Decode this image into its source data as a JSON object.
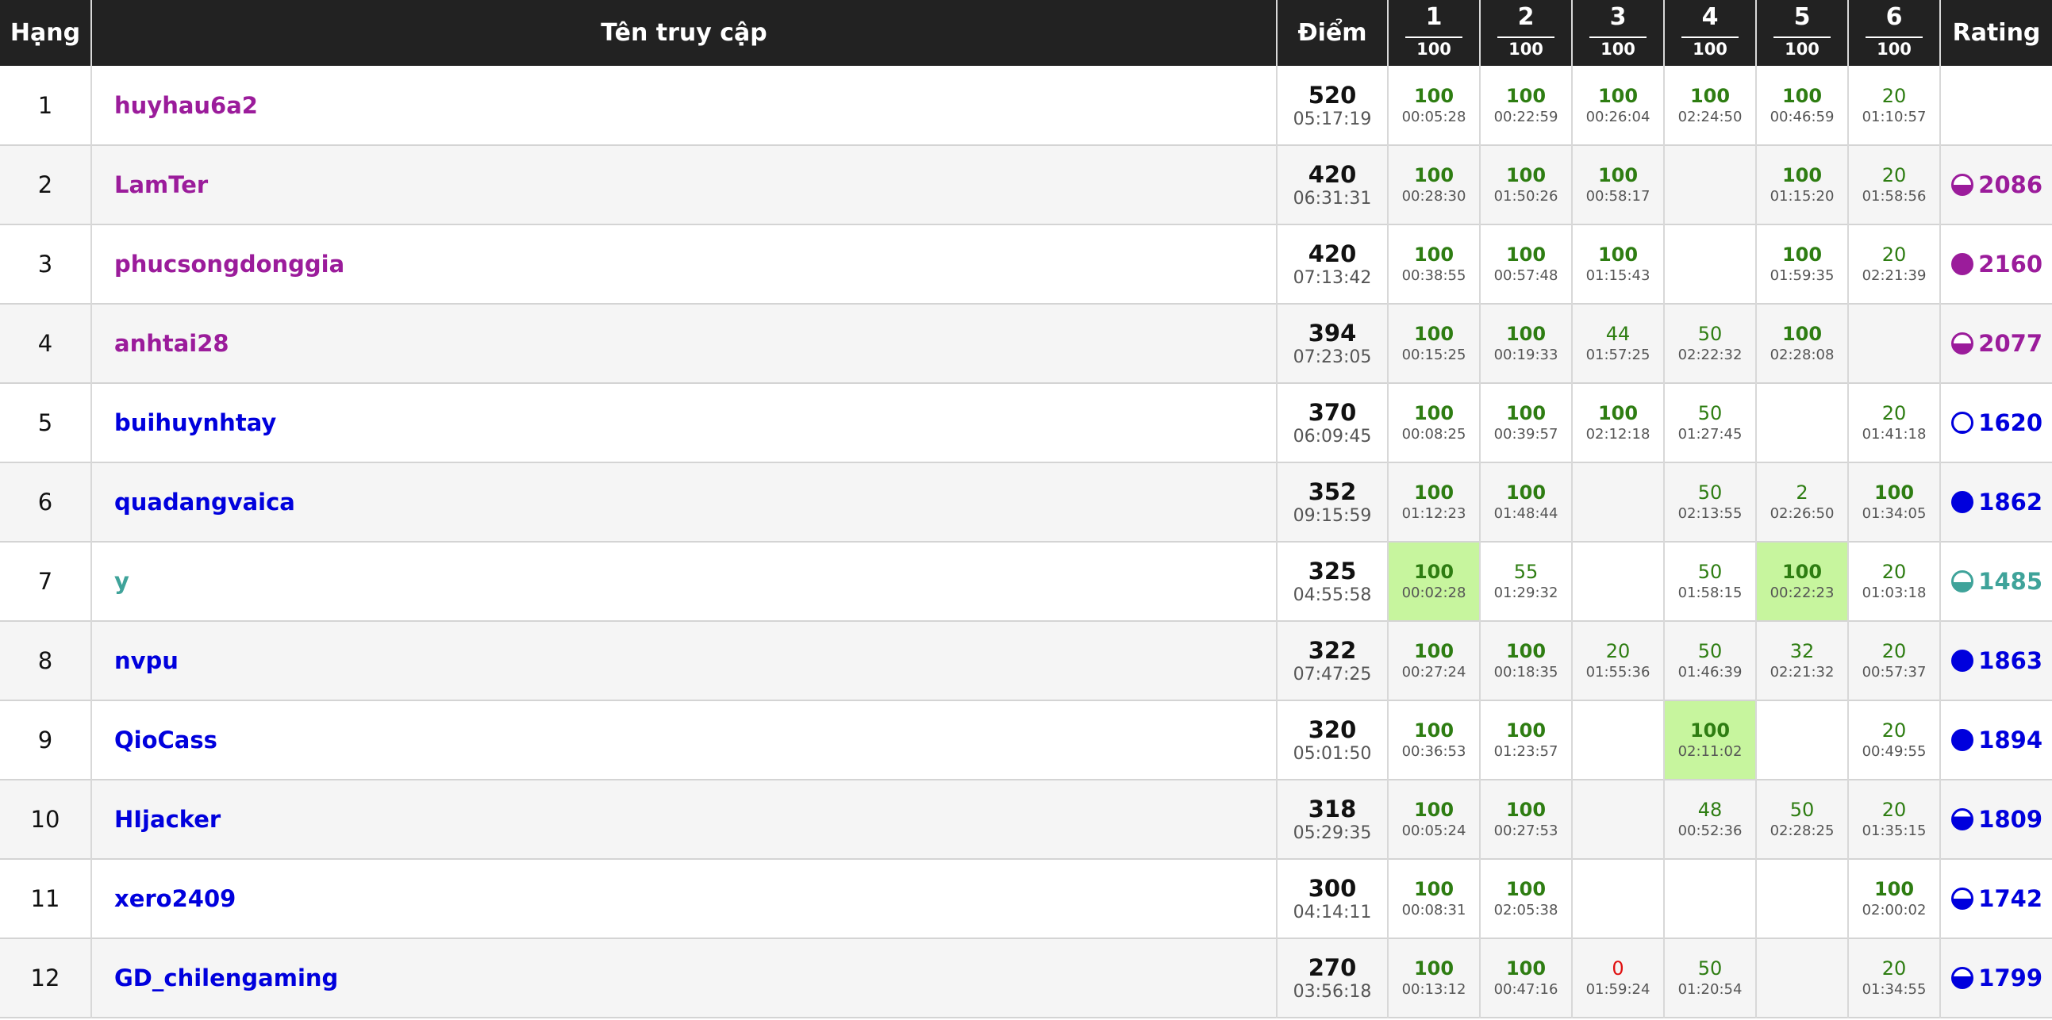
{
  "headers": {
    "rank": "Hạng",
    "username": "Tên truy cập",
    "points": "Điểm",
    "problems": [
      {
        "num": "1",
        "max": "100"
      },
      {
        "num": "2",
        "max": "100"
      },
      {
        "num": "3",
        "max": "100"
      },
      {
        "num": "4",
        "max": "100"
      },
      {
        "num": "5",
        "max": "100"
      },
      {
        "num": "6",
        "max": "100"
      }
    ],
    "rating": "Rating"
  },
  "colors": {
    "purple": "#9b1c9b",
    "blue": "#0000dd",
    "teal": "#3fa39a",
    "score_green": "#2e7d12",
    "score_red": "#e01010",
    "first_solve_bg": "#c7f59e"
  },
  "rows": [
    {
      "rank": "1",
      "user": "huyhau6a2",
      "user_color": "#9b1c9b",
      "points": "520",
      "time": "05:17:19",
      "problems": [
        {
          "score": "100",
          "time": "00:05:28"
        },
        {
          "score": "100",
          "time": "00:22:59"
        },
        {
          "score": "100",
          "time": "00:26:04"
        },
        {
          "score": "100",
          "time": "02:24:50"
        },
        {
          "score": "100",
          "time": "00:46:59"
        },
        {
          "score": "20",
          "time": "01:10:57"
        }
      ],
      "rating": {
        "value": "",
        "color": "#9b1c9b",
        "fill": 0
      }
    },
    {
      "rank": "2",
      "user": "LamTer",
      "user_color": "#9b1c9b",
      "points": "420",
      "time": "06:31:31",
      "problems": [
        {
          "score": "100",
          "time": "00:28:30"
        },
        {
          "score": "100",
          "time": "01:50:26"
        },
        {
          "score": "100",
          "time": "00:58:17"
        },
        null,
        {
          "score": "100",
          "time": "01:15:20"
        },
        {
          "score": "20",
          "time": "01:58:56"
        }
      ],
      "rating": {
        "value": "2086",
        "color": "#9b1c9b",
        "fill": 0.5
      }
    },
    {
      "rank": "3",
      "user": "phucsongdonggia",
      "user_color": "#9b1c9b",
      "points": "420",
      "time": "07:13:42",
      "problems": [
        {
          "score": "100",
          "time": "00:38:55"
        },
        {
          "score": "100",
          "time": "00:57:48"
        },
        {
          "score": "100",
          "time": "01:15:43"
        },
        null,
        {
          "score": "100",
          "time": "01:59:35"
        },
        {
          "score": "20",
          "time": "02:21:39"
        }
      ],
      "rating": {
        "value": "2160",
        "color": "#9b1c9b",
        "fill": 1
      }
    },
    {
      "rank": "4",
      "user": "anhtai28",
      "user_color": "#9b1c9b",
      "points": "394",
      "time": "07:23:05",
      "problems": [
        {
          "score": "100",
          "time": "00:15:25"
        },
        {
          "score": "100",
          "time": "00:19:33"
        },
        {
          "score": "44",
          "time": "01:57:25"
        },
        {
          "score": "50",
          "time": "02:22:32"
        },
        {
          "score": "100",
          "time": "02:28:08"
        },
        null
      ],
      "rating": {
        "value": "2077",
        "color": "#9b1c9b",
        "fill": 0.5
      }
    },
    {
      "rank": "5",
      "user": "buihuynhtay",
      "user_color": "#0000dd",
      "points": "370",
      "time": "06:09:45",
      "problems": [
        {
          "score": "100",
          "time": "00:08:25"
        },
        {
          "score": "100",
          "time": "00:39:57"
        },
        {
          "score": "100",
          "time": "02:12:18"
        },
        {
          "score": "50",
          "time": "01:27:45"
        },
        null,
        {
          "score": "20",
          "time": "01:41:18"
        }
      ],
      "rating": {
        "value": "1620",
        "color": "#0000dd",
        "fill": 0.05
      }
    },
    {
      "rank": "6",
      "user": "quadangvaica",
      "user_color": "#0000dd",
      "points": "352",
      "time": "09:15:59",
      "problems": [
        {
          "score": "100",
          "time": "01:12:23"
        },
        {
          "score": "100",
          "time": "01:48:44"
        },
        null,
        {
          "score": "50",
          "time": "02:13:55"
        },
        {
          "score": "2",
          "time": "02:26:50"
        },
        {
          "score": "100",
          "time": "01:34:05"
        }
      ],
      "rating": {
        "value": "1862",
        "color": "#0000dd",
        "fill": 1
      }
    },
    {
      "rank": "7",
      "user": "y",
      "user_color": "#3fa39a",
      "points": "325",
      "time": "04:55:58",
      "problems": [
        {
          "score": "100",
          "time": "00:02:28",
          "first": true
        },
        {
          "score": "55",
          "time": "01:29:32"
        },
        null,
        {
          "score": "50",
          "time": "01:58:15"
        },
        {
          "score": "100",
          "time": "00:22:23",
          "first": true
        },
        {
          "score": "20",
          "time": "01:03:18"
        }
      ],
      "rating": {
        "value": "1485",
        "color": "#3fa39a",
        "fill": 0.45
      }
    },
    {
      "rank": "8",
      "user": "nvpu",
      "user_color": "#0000dd",
      "points": "322",
      "time": "07:47:25",
      "problems": [
        {
          "score": "100",
          "time": "00:27:24"
        },
        {
          "score": "100",
          "time": "00:18:35"
        },
        {
          "score": "20",
          "time": "01:55:36"
        },
        {
          "score": "50",
          "time": "01:46:39"
        },
        {
          "score": "32",
          "time": "02:21:32"
        },
        {
          "score": "20",
          "time": "00:57:37"
        }
      ],
      "rating": {
        "value": "1863",
        "color": "#0000dd",
        "fill": 1
      }
    },
    {
      "rank": "9",
      "user": "QioCass",
      "user_color": "#0000dd",
      "points": "320",
      "time": "05:01:50",
      "problems": [
        {
          "score": "100",
          "time": "00:36:53"
        },
        {
          "score": "100",
          "time": "01:23:57"
        },
        null,
        {
          "score": "100",
          "time": "02:11:02",
          "first": true
        },
        null,
        {
          "score": "20",
          "time": "00:49:55"
        }
      ],
      "rating": {
        "value": "1894",
        "color": "#0000dd",
        "fill": 1
      }
    },
    {
      "rank": "10",
      "user": "HIjacker",
      "user_color": "#0000dd",
      "points": "318",
      "time": "05:29:35",
      "problems": [
        {
          "score": "100",
          "time": "00:05:24"
        },
        {
          "score": "100",
          "time": "00:27:53"
        },
        null,
        {
          "score": "48",
          "time": "00:52:36"
        },
        {
          "score": "50",
          "time": "02:28:25"
        },
        {
          "score": "20",
          "time": "01:35:15"
        }
      ],
      "rating": {
        "value": "1809",
        "color": "#0000dd",
        "fill": 0.65
      }
    },
    {
      "rank": "11",
      "user": "xero2409",
      "user_color": "#0000dd",
      "points": "300",
      "time": "04:14:11",
      "problems": [
        {
          "score": "100",
          "time": "00:08:31"
        },
        {
          "score": "100",
          "time": "02:05:38"
        },
        null,
        null,
        null,
        {
          "score": "100",
          "time": "02:00:02"
        }
      ],
      "rating": {
        "value": "1742",
        "color": "#0000dd",
        "fill": 0.5
      }
    },
    {
      "rank": "12",
      "user": "GD_chilengaming",
      "user_color": "#0000dd",
      "points": "270",
      "time": "03:56:18",
      "problems": [
        {
          "score": "100",
          "time": "00:13:12"
        },
        {
          "score": "100",
          "time": "00:47:16"
        },
        {
          "score": "0",
          "time": "01:59:24",
          "zero": true
        },
        {
          "score": "50",
          "time": "01:20:54"
        },
        null,
        {
          "score": "20",
          "time": "01:34:55"
        }
      ],
      "rating": {
        "value": "1799",
        "color": "#0000dd",
        "fill": 0.6
      }
    }
  ]
}
